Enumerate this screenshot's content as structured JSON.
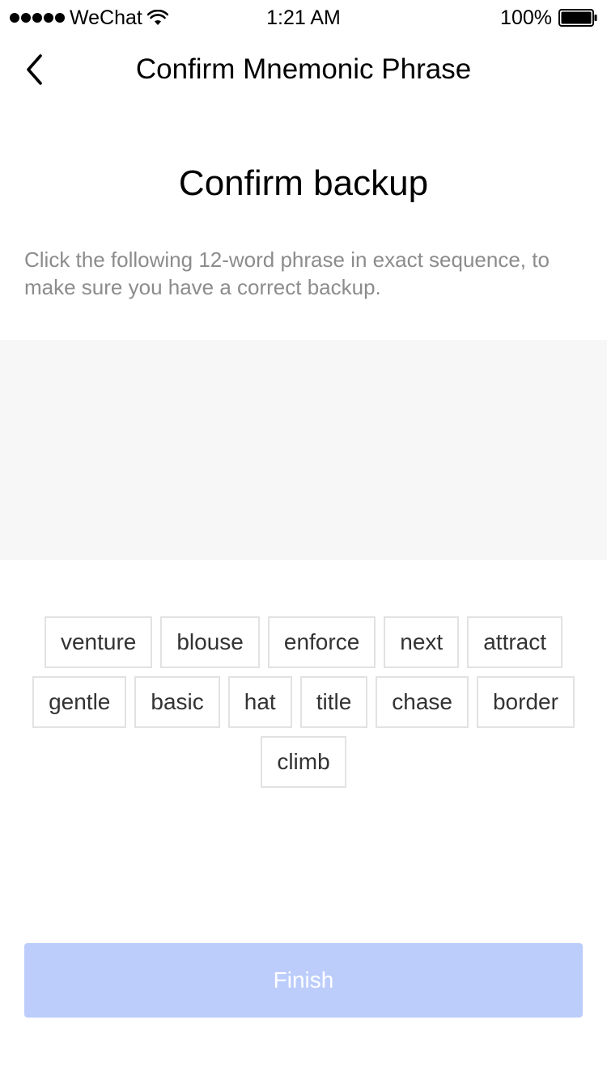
{
  "status_bar": {
    "carrier": "WeChat",
    "time": "1:21 AM",
    "battery": "100%",
    "signal_icon": "signal-dots-icon",
    "wifi_icon": "wifi-icon",
    "battery_icon": "battery-icon"
  },
  "nav": {
    "title": "Confirm Mnemonic Phrase",
    "back_icon": "chevron-left-icon"
  },
  "content": {
    "heading": "Confirm backup",
    "instructions": "Click the following 12-word phrase in exact sequence, to make sure you have a correct backup."
  },
  "words": [
    "venture",
    "blouse",
    "enforce",
    "next",
    "attract",
    "gentle",
    "basic",
    "hat",
    "title",
    "chase",
    "border",
    "climb"
  ],
  "finish_button": {
    "label": "Finish"
  },
  "colors": {
    "finish_button_bg": "#bccdfc",
    "selected_area_bg": "#f7f7f7",
    "chip_border": "#e2e2e2",
    "instruction_text": "#8c8c8c"
  }
}
